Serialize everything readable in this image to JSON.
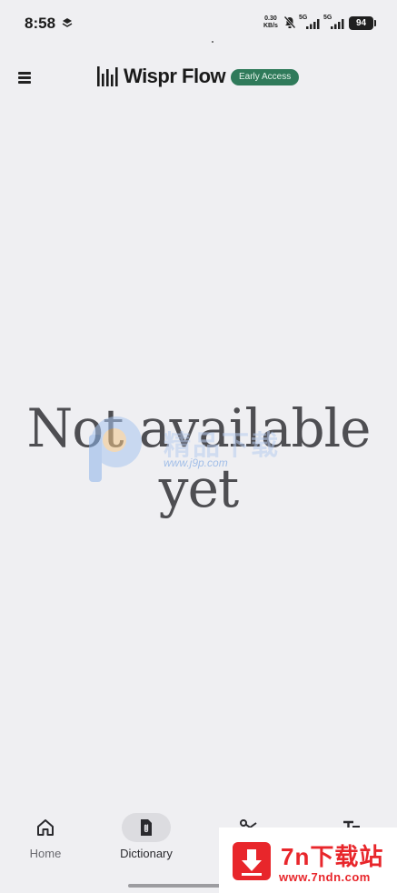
{
  "status_bar": {
    "time": "8:58",
    "net_speed_value": "0.30",
    "net_speed_unit": "KB/s",
    "signal_1_label": "5G",
    "signal_2_label": "5G",
    "battery": "94"
  },
  "header": {
    "brand": "Wispr Flow",
    "badge": "Early Access"
  },
  "main": {
    "message_line1": "Not available",
    "message_line2": "yet"
  },
  "nav": {
    "items": [
      {
        "label": "Home",
        "icon": "home-icon",
        "active": false
      },
      {
        "label": "Dictionary",
        "icon": "document-clip-icon",
        "active": true
      },
      {
        "label": "",
        "icon": "scissors-icon",
        "active": false
      },
      {
        "label": "",
        "icon": "text-style-icon",
        "active": false
      }
    ]
  },
  "watermarks": {
    "center_url": "www.j9p.com",
    "center_cn": "精品下载",
    "corner_title": "7n下载站",
    "corner_url": "www.7ndn.com"
  },
  "colors": {
    "background": "#efeff2",
    "badge": "#2f7a5a",
    "corner_watermark": "#e8262b"
  }
}
